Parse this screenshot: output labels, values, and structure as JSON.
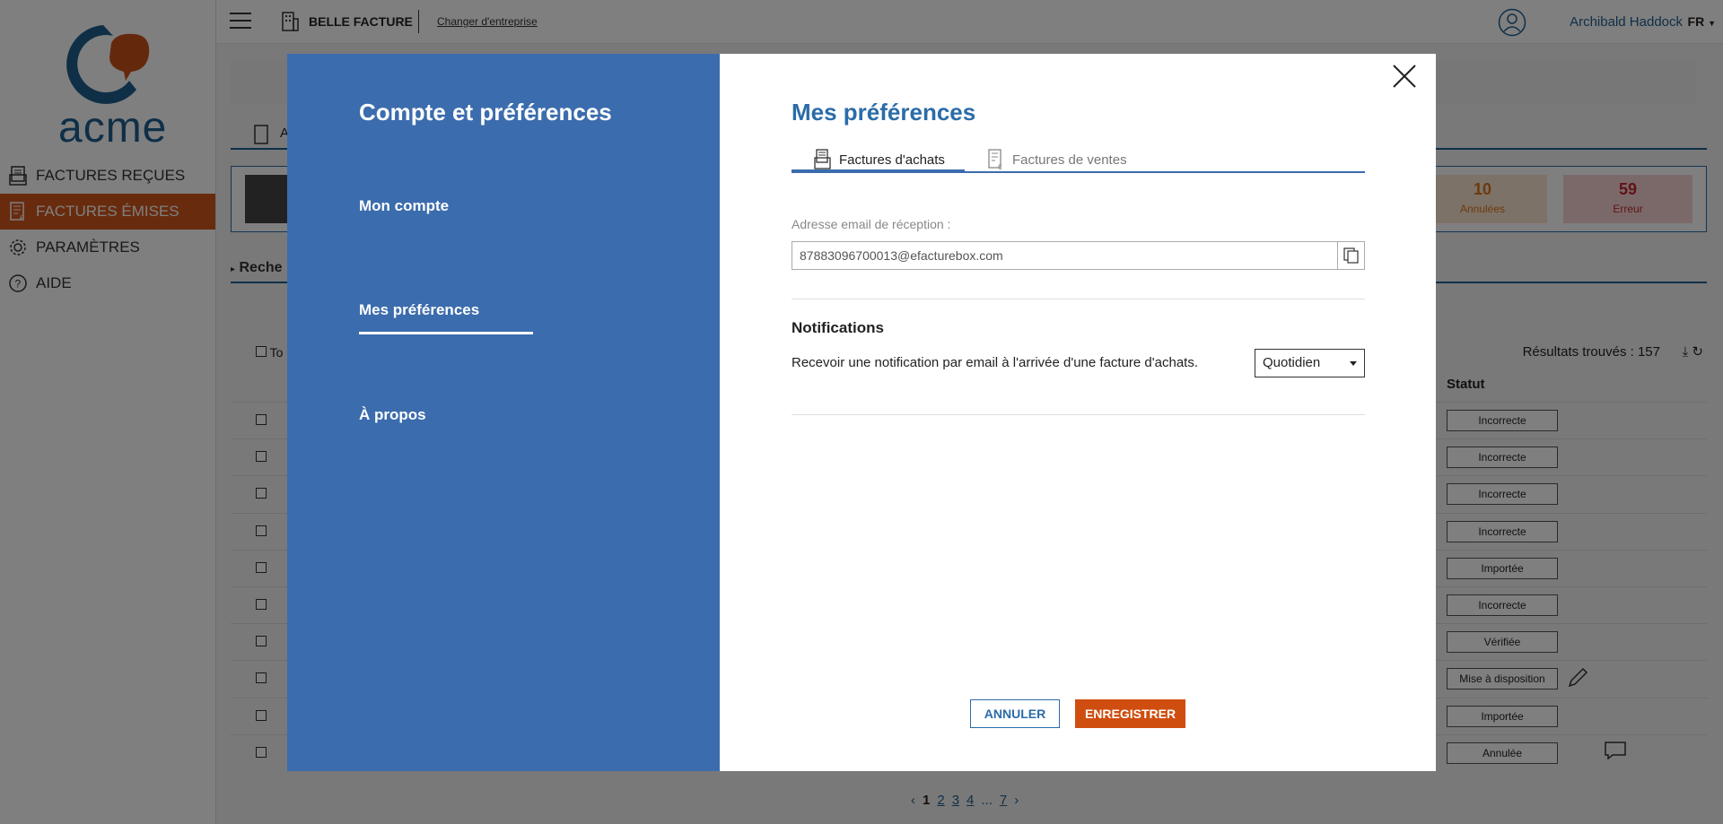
{
  "app": {
    "company": "BELLE FACTURE",
    "change_company": "Changer d'entreprise",
    "user": "Archibald Haddock",
    "lang": "FR",
    "logo_text": "acme"
  },
  "sidebar": {
    "items": [
      {
        "label": "FACTURES REÇUES",
        "icon": "received-invoices-icon"
      },
      {
        "label": "FACTURES ÉMISES",
        "icon": "issued-invoices-icon",
        "active": true
      },
      {
        "label": "PARAMÈTRES",
        "icon": "gear-icon"
      },
      {
        "label": "AIDE",
        "icon": "help-icon"
      }
    ]
  },
  "background": {
    "tab_stub": "A",
    "search_label": "Reche",
    "select_all_label": "To",
    "stats": [
      {
        "value": "10",
        "label": "Annulées"
      },
      {
        "value": "59",
        "label": "Erreur"
      }
    ],
    "results": "Résultats trouvés : 157",
    "status_header": "Statut",
    "rows": [
      {
        "status": "Incorrecte"
      },
      {
        "status": "Incorrecte"
      },
      {
        "status": "Incorrecte"
      },
      {
        "status": "Incorrecte"
      },
      {
        "status": "Importée"
      },
      {
        "status": "Incorrecte"
      },
      {
        "status": "Vérifiée"
      },
      {
        "status": "Mise à disposition",
        "icon": "pencil-icon"
      },
      {
        "status": "Importée"
      },
      {
        "status": "Annulée",
        "icon": "comment-icon"
      }
    ],
    "pagination": {
      "current": "1",
      "pages": [
        "2",
        "3",
        "4"
      ],
      "ellipsis": "...",
      "last": "7"
    }
  },
  "modal": {
    "title": "Compte et préférences",
    "menu": {
      "account": "Mon compte",
      "preferences": "Mes préférences",
      "about": "À propos"
    },
    "section_title": "Mes préférences",
    "tabs": {
      "purchases": "Factures d'achats",
      "sales": "Factures de ventes"
    },
    "email_label": "Adresse email de réception :",
    "email_value": "87883096700013@efacturebox.com",
    "notifications_title": "Notifications",
    "notifications_text": "Recevoir une notification par email à l'arrivée d'une facture d'achats.",
    "frequency": "Quotidien",
    "cancel": "ANNULER",
    "save": "ENREGISTRER"
  }
}
